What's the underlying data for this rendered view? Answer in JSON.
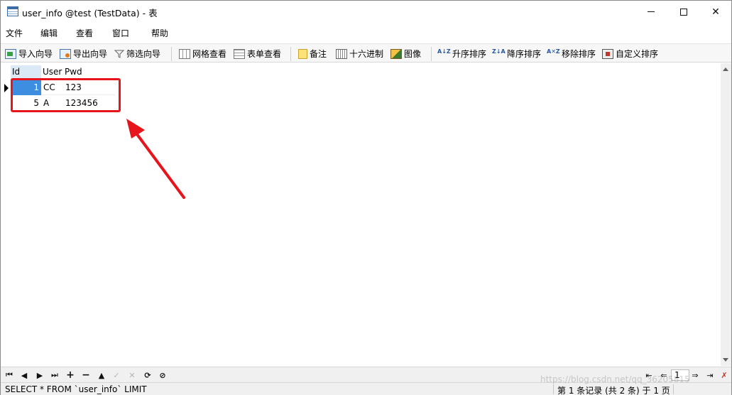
{
  "window": {
    "title": "user_info @test (TestData) - 表",
    "min_glyph": "─",
    "max_glyph": "☐",
    "close_glyph": "✕"
  },
  "menu": {
    "items": [
      "文件",
      "编辑",
      "查看",
      "窗口",
      "帮助"
    ]
  },
  "toolbar": {
    "import_wizard": "导入向导",
    "export_wizard": "导出向导",
    "filter_wizard": "筛选向导",
    "grid_view": "网格查看",
    "form_view": "表单查看",
    "memo": "备注",
    "hex": "十六进制",
    "image": "图像",
    "sort_asc": "升序排序",
    "sort_desc": "降序排序",
    "remove_sort": "移除排序",
    "custom_sort": "自定义排序",
    "sort_asc_glyph": "A↓Z",
    "sort_desc_glyph": "Z↓A",
    "remove_sort_glyph": "A✕Z"
  },
  "table": {
    "columns": [
      "Id",
      "User",
      "Pwd"
    ],
    "rows": [
      {
        "id": "1",
        "user": "CC",
        "pwd": "123"
      },
      {
        "id": "5",
        "user": "A",
        "pwd": "123456"
      }
    ],
    "selected_row": 0
  },
  "navbar": {
    "first": "⏮",
    "prev": "◀",
    "next": "▶",
    "last": "⏭",
    "add": "+",
    "delete": "−",
    "up": "▲",
    "apply": "✓",
    "discard": "✕",
    "refresh": "⟳",
    "stop": "⊘",
    "page_first": "⇤",
    "page_prev": "⇐",
    "page_value": "1",
    "page_next": "⇒",
    "page_last": "⇥",
    "settings": "✗"
  },
  "status": {
    "sql": "SELECT * FROM `user_info` LIMIT",
    "records": "第 1 条记录 (共 2 条) 于 1 页",
    "watermark": "https://blog.csdn.net/qq_36205815"
  },
  "colors": {
    "selected_cell": "#3d8ee0",
    "annotation": "#e8141c"
  }
}
